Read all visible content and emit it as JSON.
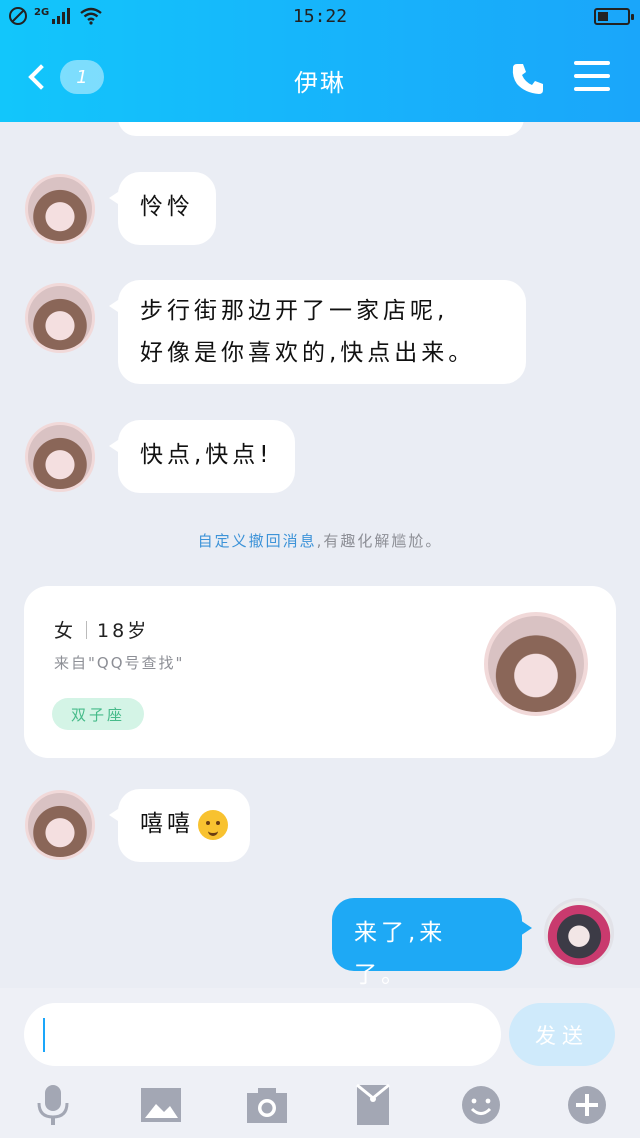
{
  "status_bar": {
    "network": "2G",
    "time": "15:22",
    "battery_level": 0.35
  },
  "header": {
    "unread_count": "1",
    "title": "伊琳"
  },
  "messages": [
    {
      "side": "left",
      "lines": [
        "怜怜"
      ]
    },
    {
      "side": "left",
      "lines": [
        "步行街那边开了一家店呢,",
        "好像是你喜欢的,快点出来。"
      ]
    },
    {
      "side": "left",
      "lines": [
        "快点,快点!"
      ]
    }
  ],
  "system_note": {
    "link_text": "自定义撤回消息",
    "rest_text": ",有趣化解尴尬。"
  },
  "profile_card": {
    "gender": "女",
    "age": "18岁",
    "source": "来自\"QQ号查找\"",
    "zodiac": "双子座"
  },
  "last_left_message": {
    "text": "嘻嘻",
    "emoji": "smile-emoji"
  },
  "my_message": {
    "text": "来了,来了。"
  },
  "input": {
    "value": "",
    "placeholder": "",
    "send_label": "发送"
  },
  "toolbar": {
    "icons": [
      "microphone-icon",
      "image-icon",
      "camera-icon",
      "red-packet-icon",
      "emoji-face-icon",
      "plus-icon"
    ]
  },
  "colors": {
    "header_start": "#12c6fb",
    "header_end": "#1aa6fa",
    "my_bubble": "#1ea9f5",
    "zodiac_tag_bg": "#d4f4e6",
    "zodiac_tag_text": "#47bb8a",
    "link": "#3d93d8"
  }
}
